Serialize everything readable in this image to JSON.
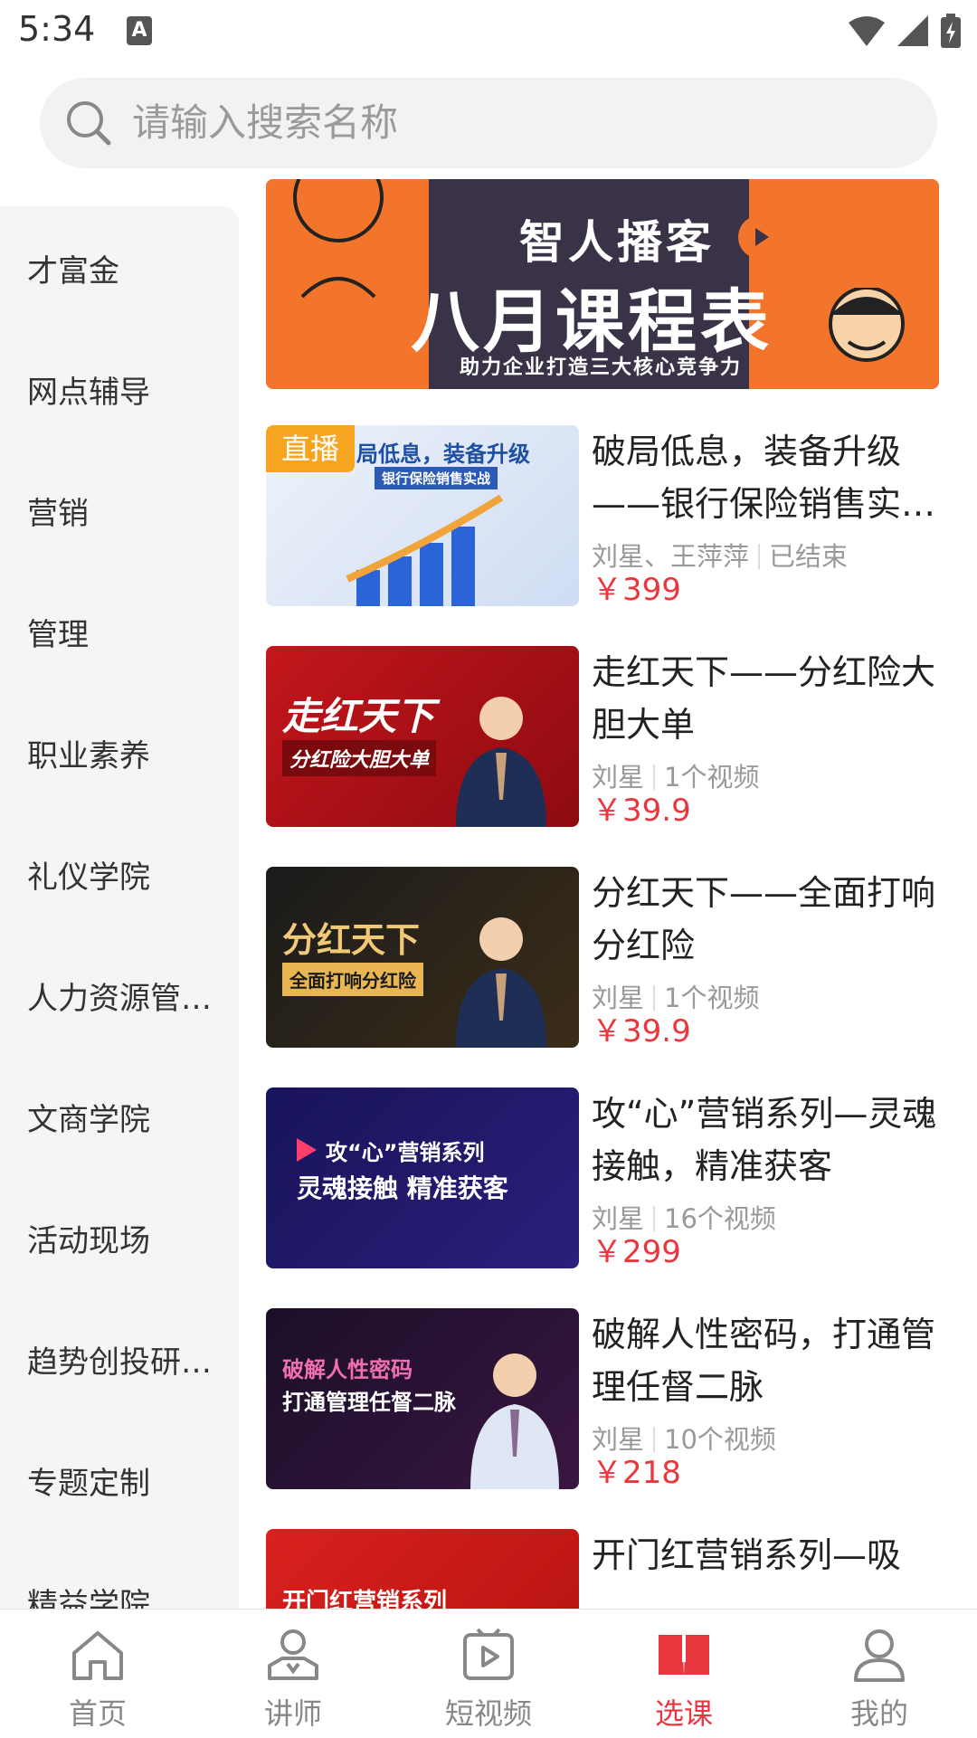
{
  "status_bar": {
    "time": "5:34",
    "a_glyph": "A"
  },
  "search": {
    "placeholder": "请输入搜索名称"
  },
  "sidebar": {
    "items": [
      {
        "label": "才富金"
      },
      {
        "label": "网点辅导"
      },
      {
        "label": "营销"
      },
      {
        "label": "管理"
      },
      {
        "label": "职业素养"
      },
      {
        "label": "礼仪学院"
      },
      {
        "label": "人力资源管…"
      },
      {
        "label": "文商学院"
      },
      {
        "label": "活动现场"
      },
      {
        "label": "趋势创投研…"
      },
      {
        "label": "专题定制"
      },
      {
        "label": "精益学院"
      }
    ]
  },
  "banner": {
    "title1": "智人播客",
    "title2": "八月课程表",
    "subtitle": "助力企业打造三大核心竞争力"
  },
  "courses": [
    {
      "badge": "直播",
      "thumb_text1": "局低息，装备升级",
      "thumb_text2": "银行保险销售实战",
      "title": "破局低息，装备升级——银行保险销售实…",
      "authors": "刘星、王萍萍",
      "status": "已结束",
      "price": "￥399"
    },
    {
      "thumb_text1": "走红天下",
      "thumb_text2": "分红险大胆大单",
      "title": "走红天下——分红险大胆大单",
      "authors": "刘星",
      "status": "1个视频",
      "price": "￥39.9"
    },
    {
      "thumb_text1": "分红天下",
      "thumb_text2": "全面打响分红险",
      "title": "分红天下——全面打响分红险",
      "authors": "刘星",
      "status": "1个视频",
      "price": "￥39.9"
    },
    {
      "thumb_text1": "攻“心”营销系列",
      "thumb_text2": "灵魂接触 精准获客",
      "title": "攻“心”营销系列—灵魂接触，精准获客",
      "authors": "刘星",
      "status": "16个视频",
      "price": "￥299"
    },
    {
      "thumb_text1": "破解人性密码",
      "thumb_text2": "打通管理任督二脉",
      "title": "破解人性密码，打通管理任督二脉",
      "authors": "刘星",
      "status": "10个视频",
      "price": "￥218"
    },
    {
      "thumb_text1": "开门红营销系列",
      "thumb_text2": "",
      "title": "开门红营销系列—吸",
      "authors": "",
      "status": "",
      "price": ""
    }
  ],
  "tabbar": {
    "items": [
      {
        "label": "首页",
        "icon": "home-icon"
      },
      {
        "label": "讲师",
        "icon": "lecturer-icon"
      },
      {
        "label": "短视频",
        "icon": "video-icon"
      },
      {
        "label": "选课",
        "icon": "book-icon"
      },
      {
        "label": "我的",
        "icon": "profile-icon"
      }
    ],
    "active_index": 3,
    "active_color": "#e9373f"
  }
}
